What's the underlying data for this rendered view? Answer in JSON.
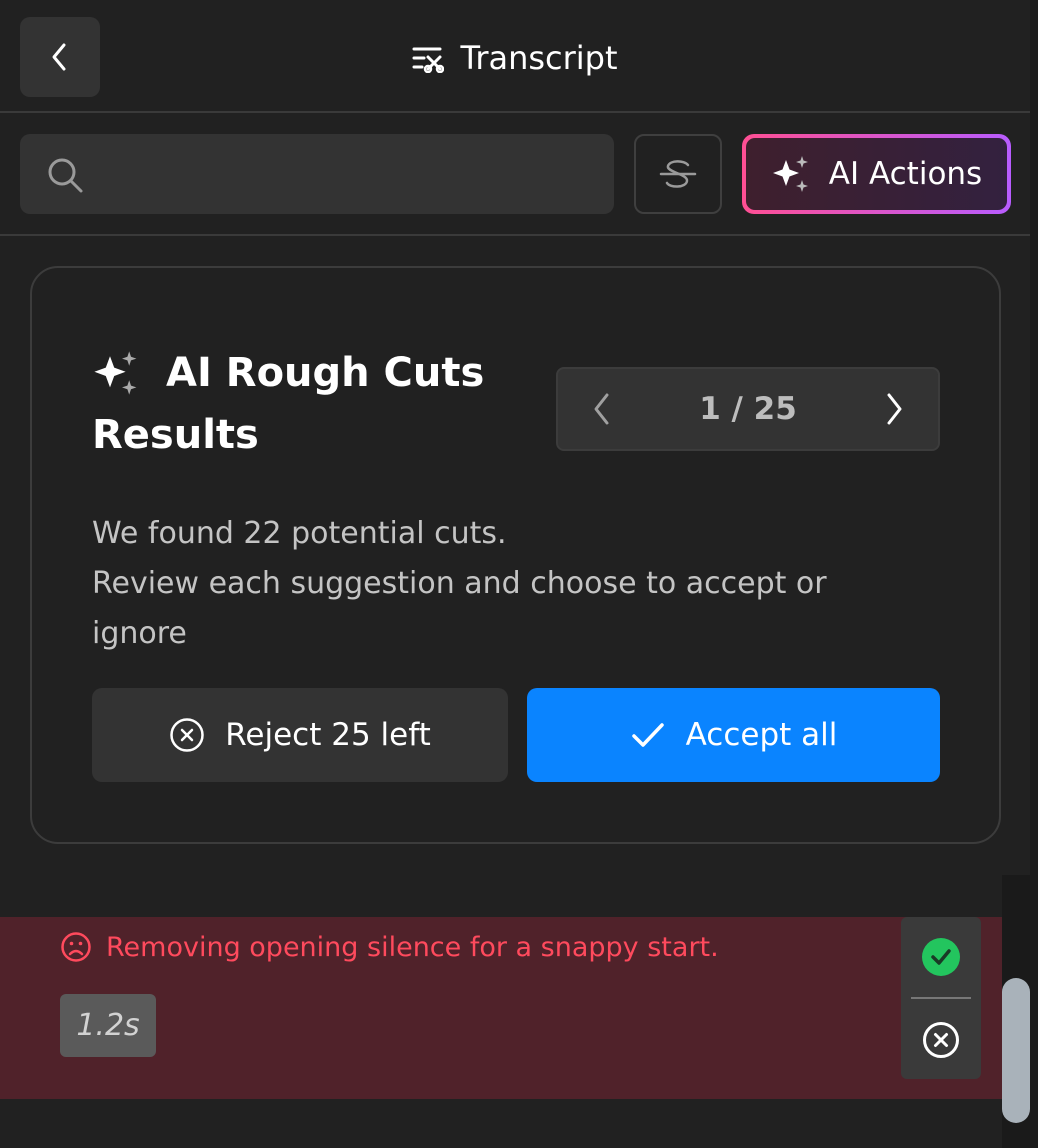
{
  "header": {
    "title": "Transcript",
    "back_icon": "chevron-left-icon",
    "title_icon": "transcript-icon"
  },
  "toolbar": {
    "search_value": "",
    "search_placeholder": "",
    "search_icon": "search-icon",
    "strike_icon": "strikethrough-icon",
    "ai_actions_label": "AI Actions",
    "ai_actions_icon": "sparkles-icon",
    "ai_gradient": [
      "#ff4f93",
      "#b85cff"
    ]
  },
  "rough_cuts": {
    "title_line1": "AI Rough Cuts",
    "title_line2": "Results",
    "pager": {
      "current": 1,
      "total": 25,
      "text": "1 / 25"
    },
    "desc_line1": "We found 22 potential cuts.",
    "desc_line2": "Review each suggestion and choose to accept or",
    "desc_line3": "ignore",
    "reject_label": "Reject 25 left",
    "accept_label": "Accept all",
    "accept_color": "#0a84ff"
  },
  "suggestion": {
    "text": "Removing opening silence for a snappy start.",
    "icon": "sad-face-icon",
    "duration": "1.2s",
    "text_color": "#ff4a5d",
    "background": "#50222a",
    "accept_icon": "check-circle-icon",
    "reject_icon": "x-circle-icon"
  },
  "scrollbar": {
    "position_fraction": 0.78
  }
}
